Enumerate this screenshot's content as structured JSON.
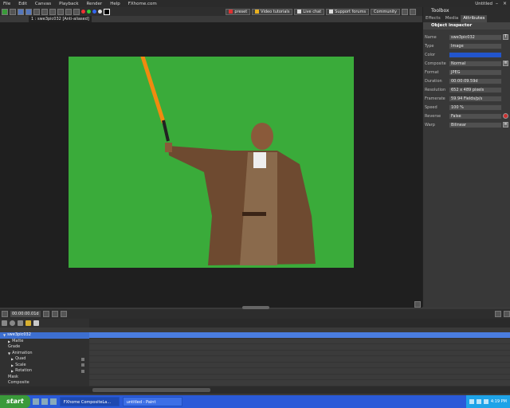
{
  "menu": [
    "File",
    "Edit",
    "Canvas",
    "Playback",
    "Render",
    "Help",
    "FXhome.com"
  ],
  "window_title": "Untitled",
  "toolbar": {
    "preset_label": "preset",
    "video_tutorials_label": "Video tutorials",
    "live_chat_label": "Live chat",
    "support_forums_label": "Support forums",
    "community_label": "Community"
  },
  "viewer": {
    "tab_label": "1 : swe3pic032 [Anti-aliased]"
  },
  "right_panel": {
    "title": "Toolbox",
    "tabs": [
      "Effects",
      "Media",
      "Attributes"
    ],
    "section": "Object inspector",
    "properties": [
      {
        "label": "Name",
        "value": "swe3pic032"
      },
      {
        "label": "Type",
        "value": "Image"
      },
      {
        "label": "Color",
        "value": ""
      },
      {
        "label": "Composite",
        "value": "Normal"
      },
      {
        "label": "Format",
        "value": "JPEG"
      },
      {
        "label": "Duration",
        "value": "00:00:09.59d"
      },
      {
        "label": "Resolution",
        "value": "652 x 489 pixels"
      },
      {
        "label": "Framerate",
        "value": "59.94 Fields/p/s"
      },
      {
        "label": "Speed",
        "value": "100 %"
      },
      {
        "label": "Reverse",
        "value": "False"
      },
      {
        "label": "Warp",
        "value": "Bilinear"
      }
    ]
  },
  "timeline": {
    "time": "00:00:00.01d",
    "layers": [
      {
        "label": "swe3pic032"
      },
      {
        "label": "Matte"
      },
      {
        "label": "Grade"
      },
      {
        "label": "Animation"
      },
      {
        "label": "Quad"
      },
      {
        "label": "Scale"
      },
      {
        "label": "Rotation"
      },
      {
        "label": "Mask"
      },
      {
        "label": "Composite"
      }
    ]
  },
  "taskbar": {
    "start_label": "start",
    "tasks": [
      "FXhome CompositeLa...",
      "untitled - Paint"
    ],
    "clock": "4:19 PM"
  }
}
